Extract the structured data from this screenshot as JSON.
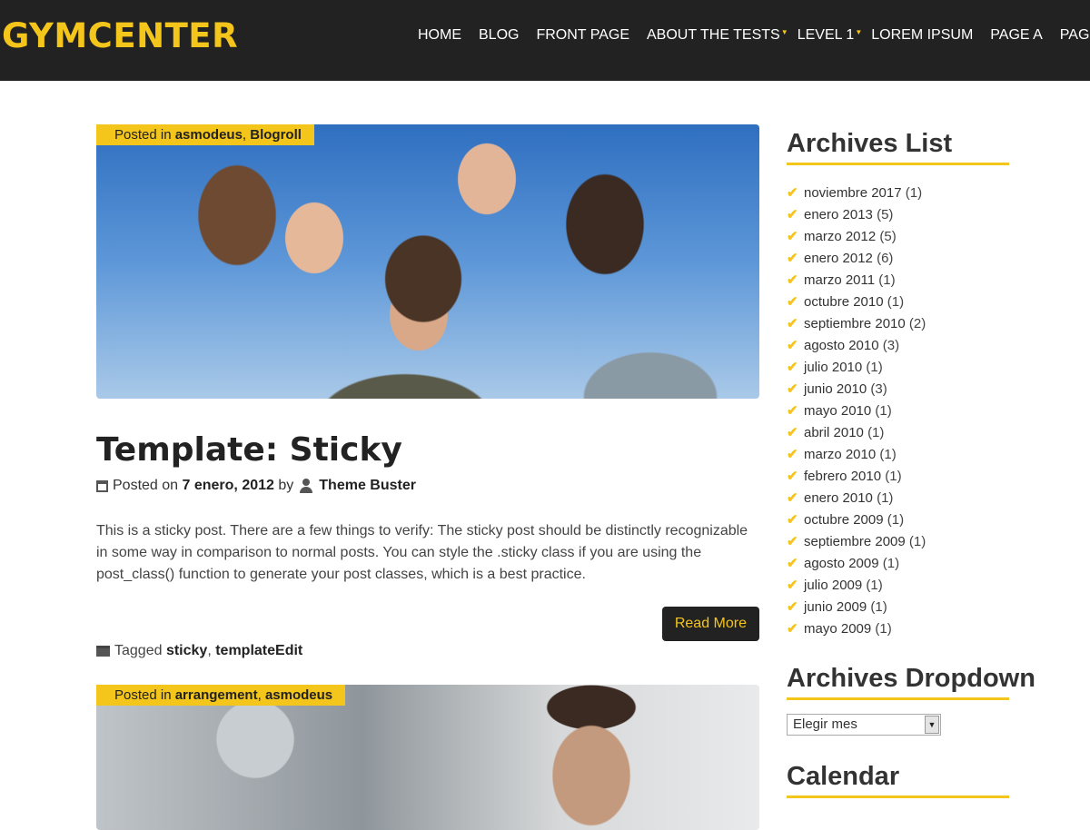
{
  "header": {
    "logo": "GYMCENTER",
    "nav": [
      {
        "label": "HOME",
        "caret": false
      },
      {
        "label": "BLOG",
        "caret": false
      },
      {
        "label": "FRONT PAGE",
        "caret": false
      },
      {
        "label": "ABOUT THE TESTS",
        "caret": true
      },
      {
        "label": "LEVEL 1",
        "caret": true
      },
      {
        "label": "LOREM IPSUM",
        "caret": false
      },
      {
        "label": "PAGE A",
        "caret": false
      },
      {
        "label": "PAGE B",
        "caret": false
      }
    ]
  },
  "post1": {
    "posted_in": "Posted in",
    "categories": [
      "asmodeus",
      "Blogroll"
    ],
    "title": "Template: Sticky",
    "posted_on": "Posted on",
    "date": "7 enero, 2012",
    "by": "by",
    "author": "Theme Buster",
    "excerpt": "This is a sticky post. There are a few things to verify: The sticky post should be distinctly recognizable in some way in comparison to normal posts. You can style the .sticky class if you are using the post_class() function to generate your post classes, which is a best practice.",
    "read_more": "Read More",
    "tagged": "Tagged",
    "tags": [
      "sticky",
      "templateEdit"
    ]
  },
  "post2": {
    "posted_in": "Posted in",
    "categories": [
      "arrangement",
      "asmodeus"
    ]
  },
  "sidebar": {
    "archives_title": "Archives List",
    "archives": [
      {
        "month": "noviembre 2017",
        "count": "(1)"
      },
      {
        "month": "enero 2013",
        "count": "(5)"
      },
      {
        "month": "marzo 2012",
        "count": "(5)"
      },
      {
        "month": "enero 2012",
        "count": "(6)"
      },
      {
        "month": "marzo 2011",
        "count": "(1)"
      },
      {
        "month": "octubre 2010",
        "count": "(1)"
      },
      {
        "month": "septiembre 2010",
        "count": "(2)"
      },
      {
        "month": "agosto 2010",
        "count": "(3)"
      },
      {
        "month": "julio 2010",
        "count": "(1)"
      },
      {
        "month": "junio 2010",
        "count": "(3)"
      },
      {
        "month": "mayo 2010",
        "count": "(1)"
      },
      {
        "month": "abril 2010",
        "count": "(1)"
      },
      {
        "month": "marzo 2010",
        "count": "(1)"
      },
      {
        "month": "febrero 2010",
        "count": "(1)"
      },
      {
        "month": "enero 2010",
        "count": "(1)"
      },
      {
        "month": "octubre 2009",
        "count": "(1)"
      },
      {
        "month": "septiembre 2009",
        "count": "(1)"
      },
      {
        "month": "agosto 2009",
        "count": "(1)"
      },
      {
        "month": "julio 2009",
        "count": "(1)"
      },
      {
        "month": "junio 2009",
        "count": "(1)"
      },
      {
        "month": "mayo 2009",
        "count": "(1)"
      }
    ],
    "dropdown_title": "Archives Dropdown",
    "dropdown_value": "Elegir mes",
    "calendar_title": "Calendar"
  },
  "colors": {
    "accent": "#f4c51a",
    "header_bg": "#222222"
  }
}
